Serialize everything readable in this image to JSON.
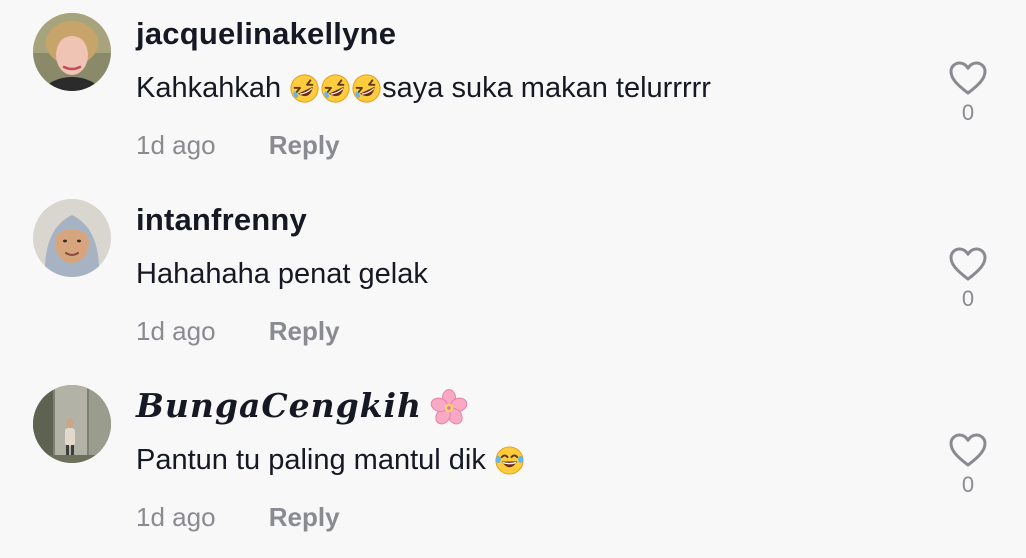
{
  "comments": [
    {
      "username": "jacquelinakellyne",
      "text_before": "Kahkahkah ",
      "text_after": "saya suka makan telurrrrr",
      "emoji": "rolling-on-floor-laughing",
      "emoji_count": 3,
      "time": "1d ago",
      "reply_label": "Reply",
      "likes": "0"
    },
    {
      "username": "intanfrenny",
      "text_before": "Hahahaha penat gelak",
      "text_after": "",
      "time": "1d ago",
      "reply_label": "Reply",
      "likes": "0"
    },
    {
      "username": "𝑩𝒖𝒏𝒈𝒂𝑪𝒆𝒏𝒈𝒌𝒊𝒉",
      "username_emoji": "cherry-blossom",
      "text_before": "Pantun tu paling mantul dik ",
      "text_after": "",
      "emoji": "face-with-tears-of-joy",
      "emoji_count": 1,
      "time": "1d ago",
      "reply_label": "Reply",
      "likes": "0"
    }
  ],
  "colors": {
    "background": "#f8f8f8",
    "text_primary": "#161823",
    "text_secondary": "#8a8b91"
  }
}
